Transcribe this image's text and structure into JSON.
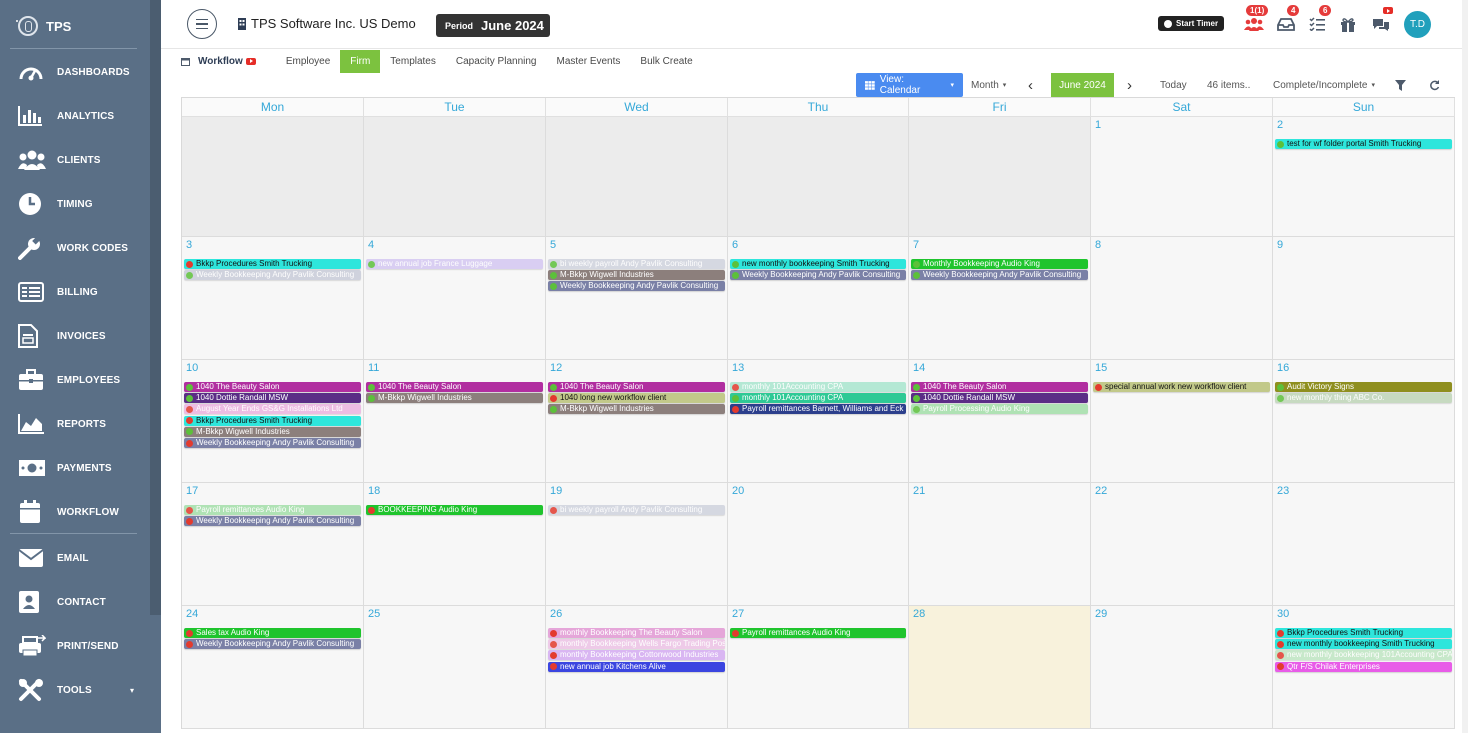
{
  "sidebar": {
    "logo": "TPS",
    "items": [
      {
        "label": "DASHBOARDS",
        "icon": "gauge-icon"
      },
      {
        "label": "ANALYTICS",
        "icon": "bar-chart-icon"
      },
      {
        "label": "CLIENTS",
        "icon": "users-icon"
      },
      {
        "label": "TIMING",
        "icon": "clock-icon"
      },
      {
        "label": "WORK CODES",
        "icon": "wrench-icon"
      },
      {
        "label": "BILLING",
        "icon": "billing-icon"
      },
      {
        "label": "INVOICES",
        "icon": "invoice-icon"
      },
      {
        "label": "EMPLOYEES",
        "icon": "briefcase-icon"
      },
      {
        "label": "REPORTS",
        "icon": "area-chart-icon"
      },
      {
        "label": "PAYMENTS",
        "icon": "money-icon"
      },
      {
        "label": "WORKFLOW",
        "icon": "calendar-icon"
      },
      {
        "label": "EMAIL",
        "icon": "envelope-icon"
      },
      {
        "label": "CONTACT",
        "icon": "contact-card-icon"
      },
      {
        "label": "PRINT/SEND",
        "icon": "print-send-icon"
      },
      {
        "label": "TOOLS",
        "icon": "tools-icon"
      }
    ]
  },
  "header": {
    "company": "TPS Software Inc. US Demo",
    "period_label": "Period",
    "period_value": "June 2024",
    "start_timer": "Start Timer",
    "badges": {
      "team": "1(1)",
      "inbox": "4",
      "tasks": "6"
    },
    "avatar": "T.D"
  },
  "tabs": {
    "workflow": "Workflow",
    "items": [
      "Employee",
      "Firm",
      "Templates",
      "Capacity Planning",
      "Master Events",
      "Bulk Create"
    ],
    "active": "Firm"
  },
  "toolbar": {
    "view": "View: Calendar",
    "mode": "Month",
    "month": "June 2024",
    "today": "Today",
    "items": "46 items..",
    "filter_status": "Complete/Incomplete"
  },
  "calendar": {
    "days": [
      "Mon",
      "Tue",
      "Wed",
      "Thu",
      "Fri",
      "Sat",
      "Sun"
    ],
    "weeks": [
      [
        {
          "day": "",
          "off": true,
          "events": []
        },
        {
          "day": "",
          "off": true,
          "events": []
        },
        {
          "day": "",
          "off": true,
          "events": []
        },
        {
          "day": "",
          "off": true,
          "events": []
        },
        {
          "day": "",
          "off": true,
          "events": []
        },
        {
          "day": "1",
          "events": []
        },
        {
          "day": "2",
          "events": [
            {
              "t": "test for wf folder portal Smith Trucking",
              "c": "#2ee6dc",
              "s": "ok"
            }
          ]
        }
      ],
      [
        {
          "day": "3",
          "events": [
            {
              "t": "Bkkp Procedures Smith Trucking",
              "c": "#2ee6dc",
              "s": "warn"
            },
            {
              "t": "Weekly Bookkeeping Andy Pavlik Consulting",
              "c": "#c9ccd9",
              "s": "ok",
              "faded": true
            }
          ]
        },
        {
          "day": "4",
          "events": [
            {
              "t": "new annual job France Luggage",
              "c": "#d4c8f2",
              "s": "ok",
              "faded": true
            }
          ]
        },
        {
          "day": "5",
          "events": [
            {
              "t": "bi weekly payroll Andy Pavlik Consulting",
              "c": "#d0d3de",
              "s": "ok",
              "faded": true
            },
            {
              "t": "M-Bkkp Wigwell Industries",
              "c": "#8c7f7c",
              "s": "ok",
              "light": true
            },
            {
              "t": "Weekly Bookkeeping Andy Pavlik Consulting",
              "c": "#7a80a6",
              "s": "ok",
              "light": true
            }
          ]
        },
        {
          "day": "6",
          "events": [
            {
              "t": "new monthly bookkeeping Smith Trucking",
              "c": "#2ee6dc",
              "s": "ok"
            },
            {
              "t": "Weekly Bookkeeping Andy Pavlik Consulting",
              "c": "#7a80a6",
              "s": "ok",
              "light": true
            }
          ]
        },
        {
          "day": "7",
          "events": [
            {
              "t": "Monthly Bookkeeping Audio King",
              "c": "#1fc42d",
              "s": "ok",
              "light": true
            },
            {
              "t": "Weekly Bookkeeping Andy Pavlik Consulting",
              "c": "#7a80a6",
              "s": "ok",
              "light": true
            }
          ]
        },
        {
          "day": "8",
          "events": []
        },
        {
          "day": "9",
          "events": []
        }
      ],
      [
        {
          "day": "10",
          "events": [
            {
              "t": "1040 The Beauty Salon",
              "c": "#b12ea0",
              "s": "ok",
              "light": true
            },
            {
              "t": "1040 Dottie Randall MSW",
              "c": "#5b2d86",
              "s": "ok",
              "light": true
            },
            {
              "t": "August Year Ends GS&G Installations Ltd",
              "c": "#ecb3e0",
              "s": "warn",
              "faded": true
            },
            {
              "t": "Bkkp Procedures Smith Trucking",
              "c": "#2ee6dc",
              "s": "warn"
            },
            {
              "t": "M-Bkkp Wigwell Industries",
              "c": "#8c7f7c",
              "s": "ok",
              "light": true
            },
            {
              "t": "Weekly Bookkeeping Andy Pavlik Consulting",
              "c": "#7a80a6",
              "s": "warn",
              "light": true
            }
          ]
        },
        {
          "day": "11",
          "events": [
            {
              "t": "1040 The Beauty Salon",
              "c": "#b12ea0",
              "s": "ok",
              "light": true
            },
            {
              "t": "M-Bkkp Wigwell Industries",
              "c": "#8c7f7c",
              "s": "ok",
              "light": true
            }
          ]
        },
        {
          "day": "12",
          "events": [
            {
              "t": "1040 The Beauty Salon",
              "c": "#b12ea0",
              "s": "ok",
              "light": true
            },
            {
              "t": "1040 long new workflow client",
              "c": "#c2c98a",
              "s": "warn"
            },
            {
              "t": "M-Bkkp Wigwell Industries",
              "c": "#8c7f7c",
              "s": "ok",
              "light": true
            }
          ]
        },
        {
          "day": "13",
          "events": [
            {
              "t": "monthly 101Accounting CPA",
              "c": "#a9e6cf",
              "s": "warn",
              "faded": true
            },
            {
              "t": "monthly 101Accounting CPA",
              "c": "#2ec995",
              "s": "ok",
              "light": true
            },
            {
              "t": "Payroll remittances Barnett, Williams and Eck",
              "c": "#2c3f8c",
              "s": "warn",
              "light": true
            }
          ]
        },
        {
          "day": "14",
          "events": [
            {
              "t": "1040 The Beauty Salon",
              "c": "#b12ea0",
              "s": "ok",
              "light": true
            },
            {
              "t": "1040 Dottie Randall MSW",
              "c": "#5b2d86",
              "s": "ok",
              "light": true
            },
            {
              "t": "Payroll Processing Audio King",
              "c": "#a3dfa9",
              "s": "ok",
              "faded": true
            }
          ]
        },
        {
          "day": "15",
          "events": [
            {
              "t": "special annual work new workflow client",
              "c": "#c2c98a",
              "s": "warn"
            }
          ]
        },
        {
          "day": "16",
          "events": [
            {
              "t": "Audit Victory Signs",
              "c": "#8f8f1f",
              "s": "ok",
              "light": true
            },
            {
              "t": "new monthly thing ABC Co.",
              "c": "#bfd6b8",
              "s": "ok",
              "faded": true
            }
          ]
        }
      ],
      [
        {
          "day": "17",
          "events": [
            {
              "t": "Payroll remittances Audio King",
              "c": "#a3dfa9",
              "s": "warn",
              "faded": true
            },
            {
              "t": "Weekly Bookkeeping Andy Pavlik Consulting",
              "c": "#7a80a6",
              "s": "warn",
              "light": true
            }
          ]
        },
        {
          "day": "18",
          "events": [
            {
              "t": "BOOKKEEPING Audio King",
              "c": "#1fc42d",
              "s": "warn",
              "light": true
            }
          ]
        },
        {
          "day": "19",
          "events": [
            {
              "t": "bi weekly payroll Andy Pavlik Consulting",
              "c": "#d0d3de",
              "s": "warn",
              "faded": true
            }
          ]
        },
        {
          "day": "20",
          "events": []
        },
        {
          "day": "21",
          "events": []
        },
        {
          "day": "22",
          "events": []
        },
        {
          "day": "23",
          "events": []
        }
      ],
      [
        {
          "day": "24",
          "events": [
            {
              "t": "Sales tax Audio King",
              "c": "#1fc42d",
              "s": "warn",
              "light": true
            },
            {
              "t": "Weekly Bookkeeping Andy Pavlik Consulting",
              "c": "#7a80a6",
              "s": "warn",
              "light": true
            }
          ]
        },
        {
          "day": "25",
          "events": []
        },
        {
          "day": "26",
          "events": [
            {
              "t": "monthly Bookkeeping The Beauty Salon",
              "c": "#e5a6d9",
              "s": "warn",
              "light": true
            },
            {
              "t": "monthly Bookkeeping Wells Fargo Trading Post",
              "c": "#edc3e6",
              "s": "warn",
              "faded": true
            },
            {
              "t": "monthly Bookkeeping Cottonwood Industries",
              "c": "#d9b6f2",
              "s": "warn",
              "light": true
            },
            {
              "t": "new annual job Kitchens Alive",
              "c": "#3b45e0",
              "s": "warn",
              "light": true
            }
          ]
        },
        {
          "day": "27",
          "events": [
            {
              "t": "Payroll remittances Audio King",
              "c": "#1fc42d",
              "s": "warn",
              "light": true
            }
          ]
        },
        {
          "day": "28",
          "today": true,
          "events": []
        },
        {
          "day": "29",
          "events": []
        },
        {
          "day": "30",
          "events": [
            {
              "t": "Bkkp Procedures Smith Trucking",
              "c": "#2ee6dc",
              "s": "red"
            },
            {
              "t": "new monthly bookkeeping Smith Trucking",
              "c": "#2ee6dc",
              "s": "red"
            },
            {
              "t": "new monthly bookkeeping 101Accounting CPA",
              "c": "#bfe6c3",
              "s": "red",
              "faded": true
            },
            {
              "t": "Qtr F/S Chilak Enterprises",
              "c": "#e85ce8",
              "s": "red",
              "light": true
            }
          ]
        }
      ]
    ]
  },
  "colors": {
    "sidebar": "#5a6f86",
    "accent_green": "#7cc23f",
    "accent_blue": "#4a8bf0",
    "day_number": "#35a8d8"
  }
}
